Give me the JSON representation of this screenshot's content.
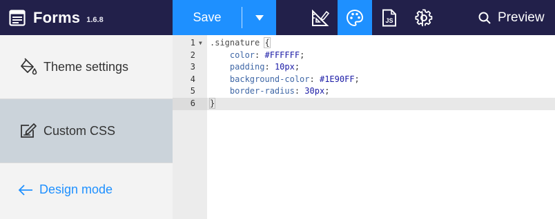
{
  "app": {
    "name": "Forms",
    "version": "1.6.8"
  },
  "toolbar": {
    "save_label": "Save",
    "dropdown_icon": "caret-down-icon",
    "tools": [
      {
        "name": "form-layout",
        "icon": "ruler-pencil-icon",
        "active": false
      },
      {
        "name": "theme",
        "icon": "palette-icon",
        "active": true
      },
      {
        "name": "javascript",
        "icon": "js-file-icon",
        "active": false
      },
      {
        "name": "settings",
        "icon": "gear-icon",
        "active": false
      }
    ],
    "preview_label": "Preview",
    "active_color": "#1E90FF",
    "bar_color": "#22204A"
  },
  "sidebar": {
    "items": [
      {
        "label": "Theme settings",
        "icon": "paint-bucket-icon",
        "active": false
      },
      {
        "label": "Custom CSS",
        "icon": "edit-square-icon",
        "active": true
      }
    ],
    "design_mode_label": "Design mode"
  },
  "editor": {
    "line_numbers": [
      "1",
      "2",
      "3",
      "4",
      "5",
      "6"
    ],
    "lines": {
      "l1_selector": ".signature",
      "l1_brace": "{",
      "l2_prop": "color",
      "l2_val": "#FFFFFF",
      "l3_prop": "padding",
      "l3_val": "10px",
      "l4_prop": "background-color",
      "l4_val": "#1E90FF",
      "l5_prop": "border-radius",
      "l5_val": "30px",
      "l6_brace": "}"
    },
    "colon": ":",
    "semicolon": ";"
  }
}
